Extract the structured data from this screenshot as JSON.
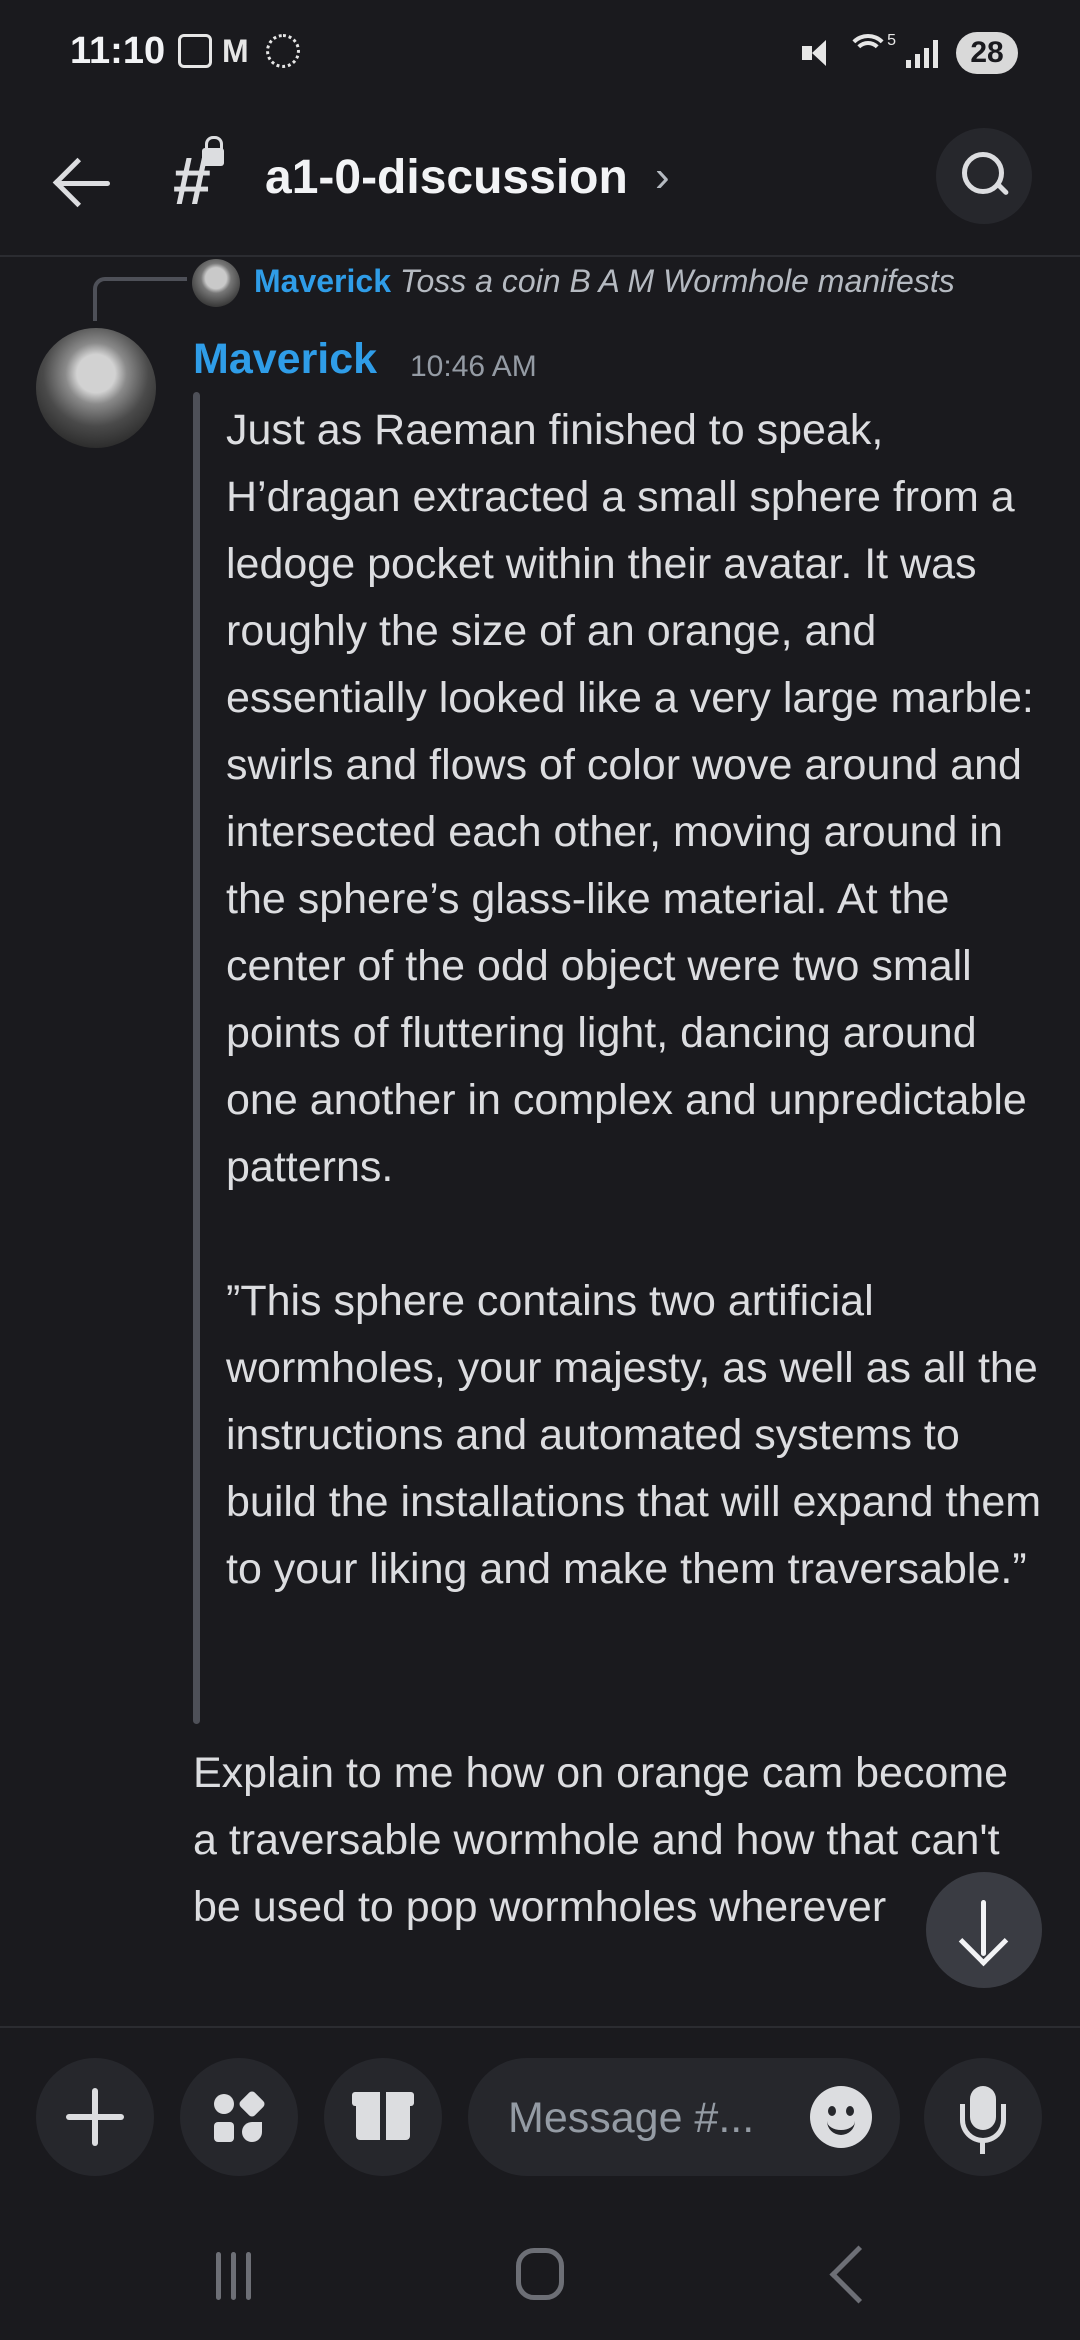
{
  "status_bar": {
    "time": "11:10",
    "battery": "28",
    "wifi_label": "5"
  },
  "header": {
    "channel_name": "a1-0-discussion",
    "chevron": "›"
  },
  "reply_ref": {
    "author": "Maverick",
    "snippet": "Toss a coin  B A M Wormhole manifests"
  },
  "message": {
    "author": "Maverick",
    "time": "10:46 AM",
    "quote": "Just as Raeman finished to speak, H’dragan extracted a small sphere from a ledoge pocket within their avatar. It was roughly the size of an orange, and essentially looked like a very large marble: swirls and flows of color wove around and intersected each other, moving around in the sphere’s glass-like material. At the center of the odd object were two small points of fluttering light, dancing around one another in complex and unpredictable patterns.\n\n”This sphere contains two artificial wormholes, your majesty, as well as all the instructions and automated systems to build the installations that will expand them to your liking and make them traversable.”",
    "body": "Explain to me how on orange cam become a traversable wormhole and how that can't be used to pop wormholes wherever"
  },
  "composer": {
    "placeholder": "Message #..."
  },
  "icons": {
    "back": "arrow-left-icon",
    "search": "search-icon",
    "jump": "arrow-down-icon",
    "plus": "plus-icon",
    "apps": "apps-icon",
    "gift": "gift-icon",
    "emoji": "emoji-icon",
    "mic": "microphone-icon"
  },
  "colors": {
    "background": "#1a1a1e",
    "accent_name": "#2f9de8",
    "text": "#dcdde0",
    "muted": "#949ba4"
  }
}
